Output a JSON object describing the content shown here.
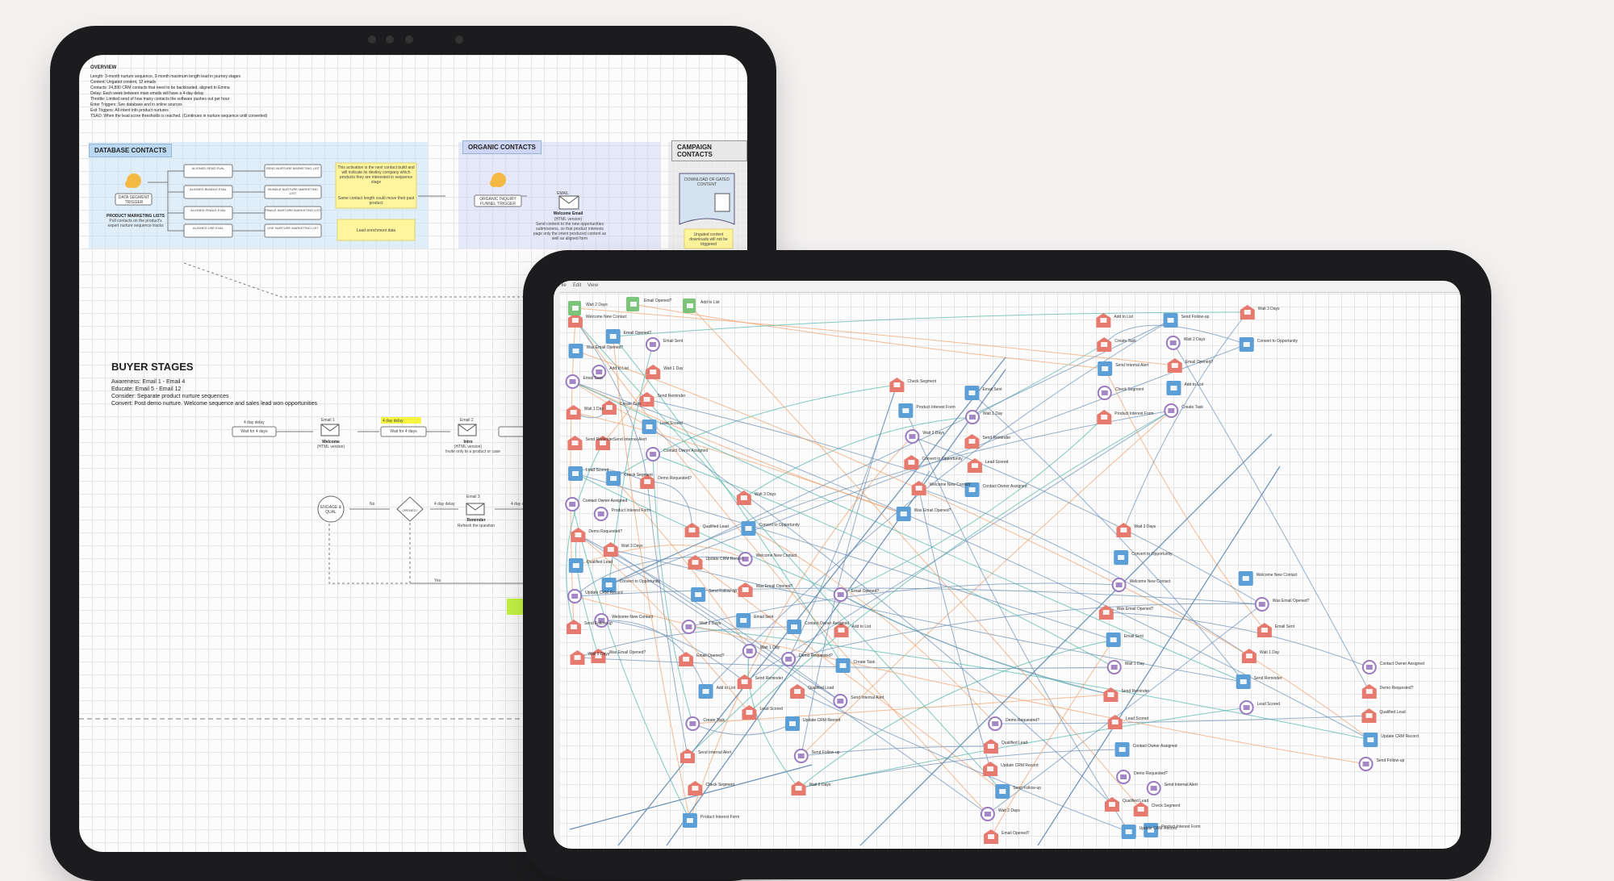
{
  "back_screen": {
    "overview": {
      "heading": "OVERVIEW",
      "lines": [
        "Length: 3-month nurture sequence, 3-month maximum length lead in journey stages",
        "Content: Ungated content, 12 emails",
        "Contacts: 24,890 CRM contacts that need to be backloaded, aligned to Emma",
        "Delay: Each week between main emails will have a 4-day delay",
        "Throttle: Limited send of how many contacts the software pushes out per hour",
        "Enter Triggers: See database and in online sources",
        "Exit Triggers: All intent info product nurtures",
        "TSAO: When the lead score thresholds is reached. (Continues in nurture sequence until converted)"
      ]
    },
    "sections": {
      "database": "DATABASE CONTACTS",
      "organic": "ORGANIC CONTACTS",
      "campaign": "CAMPAIGN CONTACTS"
    },
    "database_flow": {
      "trigger": "DATA SEGMENT TRIGGER",
      "lists_caption": "PRODUCT MARKETING LISTS",
      "lists_sub": "Pull contacts on the product's expert nurture sequence tracks",
      "segments": [
        "ALIGNED SEND EVAL",
        "ALIGNED BUNDLE EVAL",
        "ALIGNED FINALE EVAL",
        "ALIGNED USE EVAL"
      ],
      "targets": [
        "SEND NURTURE MARKETING LIST",
        "BUNDLE NURTURE MARKETING LIST",
        "FINALE NURTURE MARKETING LIST",
        "USE NURTURE MARKETING LIST"
      ],
      "note1": "This activation is the next contact build and will indicate its destiny company which products they are interested in sequence stage",
      "note2": "Same contact length could move their past product",
      "note3": "Lead enrichment data"
    },
    "organic_flow": {
      "trigger": "ORGANIC INQUIRY FUNNEL TRIGGER",
      "email_label": "EMAIL",
      "email_title": "Welcome Email",
      "email_sub": "(HTML version)",
      "email_desc": "Send content to the new opportunities submissions, so that product interests page only the intent produced content as well as aligned form"
    },
    "campaign_flow": {
      "doc": "DOWNLOAD OF GATED CONTENT",
      "note": "Ungated content downloads will not be triggered"
    },
    "buyer_stages": {
      "title": "BUYER STAGES",
      "lines": [
        "Awareness: Email 1 - Email 4",
        "Educate: Email 5 - Email 12",
        "Consider: Separate product nurture sequences",
        "Convert: Post demo nurture. Welcome sequence and sales lead won opportunities"
      ]
    },
    "stage_flow": {
      "delay1": "4 day delay",
      "wait1": "Wait for 4 days",
      "email1": "Email 1",
      "email1_title": "Welcome",
      "email1_sub": "(HTML version)",
      "highlight": "4 day delay",
      "wait2": "Wait for 4 days",
      "email2": "Email 2",
      "email2_title": "Intro",
      "email2_sub": "(HTML version)",
      "email2_desc": "Invite only to a product or case",
      "branch_start": "ENGAGE & QUAL",
      "decision": "OPENED?",
      "no_label": "No",
      "yes_label": "Yes",
      "delay2": "4 day delay",
      "delay3": "4 day delay",
      "email3": "Email 3",
      "email3_title": "Reminder",
      "email3_sub": "Refresh the question"
    }
  },
  "front_screen": {
    "menu_items": [
      "File",
      "Edit",
      "View"
    ],
    "column_headers": [
      "Welcome New Contact",
      "Personalized Contacts",
      "New Lead Nurture Campaign"
    ],
    "node_labels": [
      "Welcome New Contact",
      "Was Email Opened?",
      "Email Sent",
      "Wait 1 Day",
      "Send Reminder",
      "Lead Scored",
      "Contact Owner Assigned",
      "Demo Requested?",
      "Qualified Lead",
      "Update CRM Record",
      "Send Follow-up",
      "Wait 2 Days",
      "Email Opened?",
      "Add to List",
      "Create Task",
      "Send Internal Alert",
      "Check Segment",
      "Product Interest Form",
      "Wait 3 Days",
      "Convert to Opportunity"
    ],
    "colors": {
      "red_node": "#e77a6e",
      "blue_node": "#5b9fd6",
      "purple_node": "#9a7bbf",
      "green_node": "#7cc47a",
      "edge_blue": "#6a8fb5",
      "edge_orange": "#f0a06a",
      "edge_teal": "#4fb3a6"
    }
  }
}
